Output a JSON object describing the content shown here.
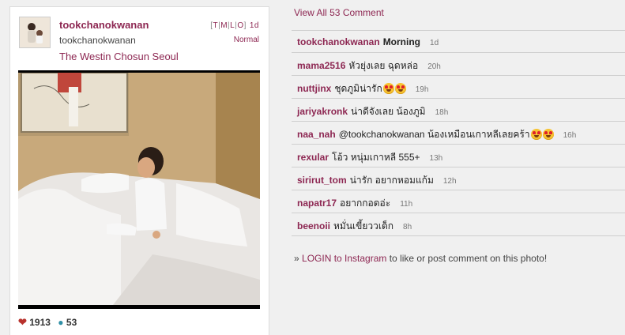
{
  "post": {
    "username": "tookchanokwanan",
    "full_name": "tookchanokwanan",
    "location": "The Westin Chosun Seoul",
    "sizes": [
      "T",
      "M",
      "L",
      "O"
    ],
    "age": "1d",
    "filter": "Normal",
    "likes": "1913",
    "comments_count": "53"
  },
  "comments_section": {
    "view_all": "View All 53 Comment",
    "items": [
      {
        "user": "tookchanokwanan",
        "text": "Morning",
        "age": "1d",
        "emoji": 0,
        "bold": true
      },
      {
        "user": "mama2516",
        "text": "หัวยุ่งเลย ฉุดหล่อ",
        "age": "20h",
        "emoji": 0
      },
      {
        "user": "nuttjinx",
        "text": "ชุดภูมิน่ารัก",
        "age": "19h",
        "emoji": 2
      },
      {
        "user": "jariyakronk",
        "text": "น่าดีจังเลย น้องภูมิ",
        "age": "18h",
        "emoji": 0
      },
      {
        "user": "naa_nah",
        "text": "@tookchanokwanan น้องเหมือนเกาหลีเลยคร้า",
        "age": "16h",
        "emoji": 2
      },
      {
        "user": "rexular",
        "text": "โอ้ว หนุ่มเกาหลี 555+",
        "age": "13h",
        "emoji": 0
      },
      {
        "user": "sirirut_tom",
        "text": "น่ารัก อยากหอมแก้ม",
        "age": "12h",
        "emoji": 0
      },
      {
        "user": "napatr17",
        "text": "อยากกอดอ่ะ",
        "age": "11h",
        "emoji": 0
      },
      {
        "user": "beenoii",
        "text": "หมั่นเขี้ยววเด็ก",
        "age": "8h",
        "emoji": 0
      }
    ],
    "login_prefix": "» ",
    "login_link": "LOGIN to Instagram",
    "login_suffix": " to like or post comment on this photo!"
  },
  "colors": {
    "accent": "#8d2752",
    "heart": "#b8322d",
    "comment_icon": "#2f8fa6"
  }
}
